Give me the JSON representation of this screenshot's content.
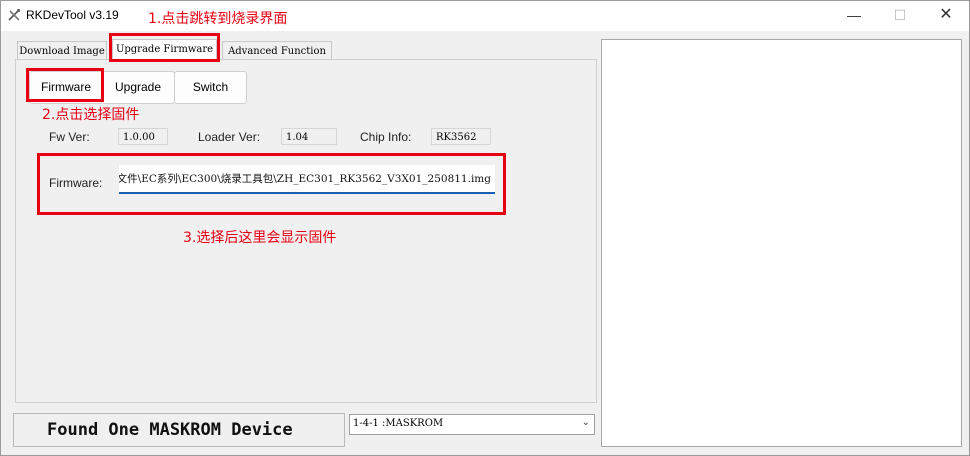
{
  "window": {
    "title": "RKDevTool v3.19",
    "minimize_glyph": "—",
    "maximize_glyph": "☐",
    "close_glyph": "✕"
  },
  "annotations": {
    "step1": "1.点击跳转到烧录界面",
    "step2": "2.点击选择固件",
    "step3": "3.选择后这里会显示固件",
    "color": "#e60012"
  },
  "tabs": [
    {
      "label": "Download Image",
      "active": false
    },
    {
      "label": "Upgrade Firmware",
      "active": true
    },
    {
      "label": "Advanced Function",
      "active": false
    }
  ],
  "toolbar": {
    "firmware_label": "Firmware",
    "upgrade_label": "Upgrade",
    "switch_label": "Switch"
  },
  "info": {
    "fw_ver_label": "Fw Ver:",
    "fw_ver_value": "1.0.00",
    "loader_ver_label": "Loader Ver:",
    "loader_ver_value": "1.04",
    "chip_info_label": "Chip Info:",
    "chip_info_value": "RK3562"
  },
  "firmware_path": {
    "label": "Firmware:",
    "value": ":文件\\EC系列\\EC300\\烧录工具包\\ZH_EC301_RK3562_V3X01_250811.img"
  },
  "status": {
    "message": "Found One MASKROM Device"
  },
  "device_select": {
    "selected": "1-4-1 :MASKROM"
  }
}
